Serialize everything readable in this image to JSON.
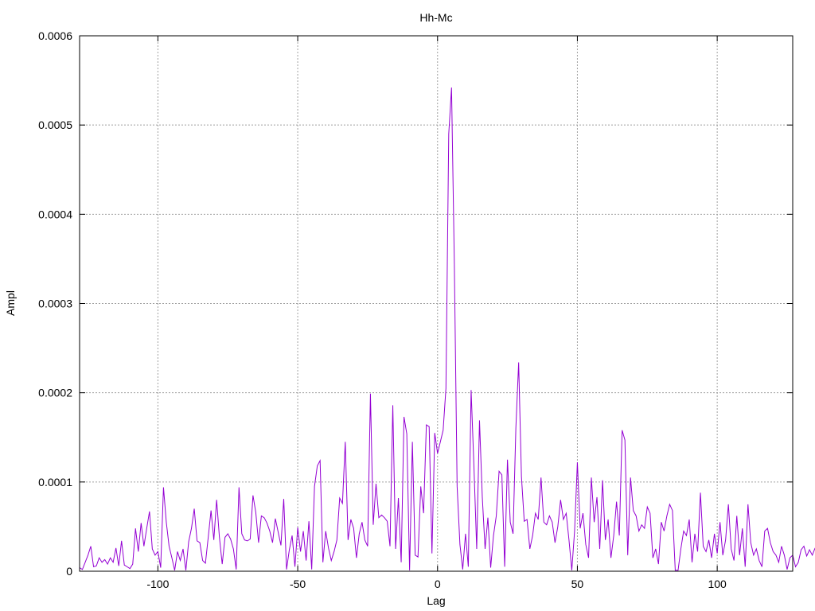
{
  "chart_data": {
    "type": "line",
    "title": "Hh-Mc",
    "xlabel": "Lag",
    "ylabel": "Ampl",
    "xlim": [
      -128,
      127
    ],
    "ylim": [
      0,
      0.0006
    ],
    "xticks": [
      -100,
      -50,
      0,
      50,
      100
    ],
    "xtick_labels": [
      "-100",
      "-50",
      "0",
      "50",
      "100"
    ],
    "yticks": [
      0,
      0.0001,
      0.0002,
      0.0003,
      0.0004,
      0.0005,
      0.0006
    ],
    "ytick_labels": [
      "0",
      "0.0001",
      "0.0002",
      "0.0003",
      "0.0004",
      "0.0005",
      "0.0006"
    ],
    "grid": true,
    "line_color": "#9400d3",
    "series": [
      {
        "values": [
          4e-06,
          2e-06,
          1e-05,
          1.8e-05,
          2.8e-05,
          5e-06,
          6e-06,
          1.5e-05,
          1e-05,
          1.3e-05,
          8e-06,
          1.5e-05,
          1e-05,
          2.6e-05,
          6e-06,
          3.4e-05,
          7e-06,
          5e-06,
          3e-06,
          8e-06,
          4.8e-05,
          2.2e-05,
          5.4e-05,
          2.8e-05,
          4.8e-05,
          6.7e-05,
          2.5e-05,
          1.8e-05,
          2.2e-05,
          4e-06,
          9.4e-05,
          5.5e-05,
          2.8e-05,
          1.5e-05,
          1e-06,
          2.2e-05,
          1.2e-05,
          2.5e-05,
          1e-06,
          3.3e-05,
          4.8e-05,
          7e-05,
          3.4e-05,
          3.2e-05,
          1.2e-05,
          9e-06,
          3.8e-05,
          6.8e-05,
          3.5e-05,
          8e-05,
          3.8e-05,
          8e-06,
          3.8e-05,
          4.2e-05,
          3.6e-05,
          2.5e-05,
          2e-06,
          9.4e-05,
          4.2e-05,
          3.5e-05,
          3.4e-05,
          3.6e-05,
          8.5e-05,
          6.6e-05,
          3.2e-05,
          6.2e-05,
          6e-05,
          5.4e-05,
          4.5e-05,
          3.2e-05,
          5.9e-05,
          4.4e-05,
          2.9e-05,
          8.1e-05,
          2e-06,
          2.4e-05,
          4e-05,
          5e-06,
          4.9e-05,
          2.2e-05,
          4.5e-05,
          1.2e-05,
          5.6e-05,
          2e-06,
          9.5e-05,
          0.000118,
          0.000124,
          1e-05,
          4.5e-05,
          2.6e-05,
          1.2e-05,
          2.2e-05,
          3.5e-05,
          8.2e-05,
          7.6e-05,
          0.000145,
          3.5e-05,
          5.8e-05,
          4.8e-05,
          1.5e-05,
          4.2e-05,
          5.5e-05,
          3.5e-05,
          2.8e-05,
          0.000199,
          5.2e-05,
          9.8e-05,
          6e-05,
          6.3e-05,
          6e-05,
          5.6e-05,
          2.8e-05,
          0.000186,
          2.5e-05,
          8.2e-05,
          1e-05,
          0.000173,
          0.000154,
          1e-06,
          0.000145,
          1.8e-05,
          1.6e-05,
          9.5e-05,
          6.5e-05,
          0.000164,
          0.000162,
          2e-05,
          0.000155,
          0.000132,
          0.000145,
          0.000158,
          0.000205,
          0.00049,
          0.000542,
          0.000345,
          9.5e-05,
          3e-05,
          2e-06,
          4.2e-05,
          5e-06,
          0.000203,
          0.000118,
          2.5e-05,
          0.000169,
          8.3e-05,
          2.5e-05,
          6e-05,
          4e-06,
          4e-05,
          6.2e-05,
          0.000112,
          0.000108,
          5e-06,
          0.000125,
          5.5e-05,
          4.2e-05,
          0.00016,
          0.000234,
          0.000106,
          5.6e-05,
          5.8e-05,
          2.5e-05,
          4e-05,
          6.5e-05,
          5.8e-05,
          0.000105,
          5.5e-05,
          5.2e-05,
          6.2e-05,
          5.5e-05,
          3.2e-05,
          5e-05,
          8e-05,
          5.8e-05,
          6.5e-05,
          3.5e-05,
          1e-06,
          4.5e-05,
          0.000122,
          4.8e-05,
          6.5e-05,
          3e-05,
          1.5e-05,
          0.000105,
          5.5e-05,
          8.3e-05,
          2.5e-05,
          0.000102,
          3.5e-05,
          5.8e-05,
          1.5e-05,
          4e-05,
          7.8e-05,
          4e-05,
          0.000158,
          0.000147,
          1.8e-05,
          0.000105,
          6.8e-05,
          6.2e-05,
          4.5e-05,
          5.2e-05,
          4.8e-05,
          7.2e-05,
          6.5e-05,
          1.5e-05,
          2.5e-05,
          8e-06,
          5.5e-05,
          4.5e-05,
          6.2e-05,
          7.5e-05,
          6.8e-05,
          1e-06,
          1e-06,
          2.5e-05,
          4.5e-05,
          4e-05,
          5.8e-05,
          1e-05,
          4.2e-05,
          2.2e-05,
          8.8e-05,
          2.8e-05,
          2.2e-05,
          3.5e-05,
          1.5e-05,
          4.2e-05,
          2e-05,
          5.5e-05,
          1.8e-05,
          3.5e-05,
          7.5e-05,
          2.5e-05,
          1.2e-05,
          6.2e-05,
          1.8e-05,
          4.8e-05,
          5e-06,
          7.5e-05,
          3.2e-05,
          1.8e-05,
          2.5e-05,
          1.2e-05,
          5e-06,
          4.5e-05,
          4.8e-05,
          3.2e-05,
          2.2e-05,
          1.8e-05,
          1e-05,
          2.8e-05,
          1.8e-05,
          2e-06,
          1.5e-05,
          1.8e-05,
          5e-06,
          1e-05,
          2.4e-05,
          2.8e-05,
          1.7e-05,
          2.4e-05,
          1.8e-05,
          2.6e-05
        ]
      }
    ]
  }
}
